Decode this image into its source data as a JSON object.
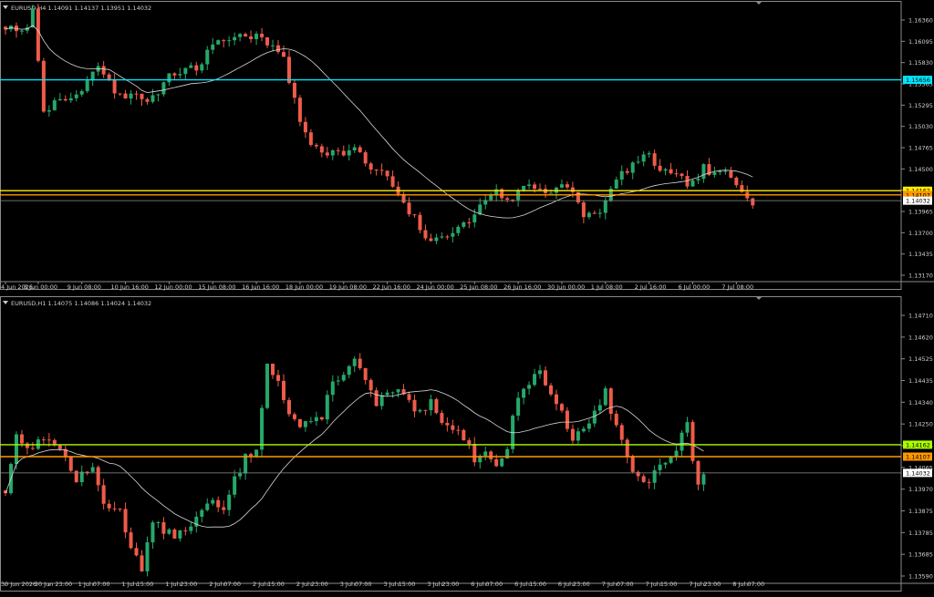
{
  "chart_data": [
    {
      "type": "candlestick",
      "title": "EURUSD,H4  1.14091 1.14137 1.13951 1.14032",
      "ylim": [
        1.1301,
        1.1651
      ],
      "y_ticks": [
        "1.16360",
        "1.16095",
        "1.15830",
        "1.15565",
        "1.15295",
        "1.15030",
        "1.14765",
        "1.14500",
        "1.14235",
        "1.13965",
        "1.13700",
        "1.13435",
        "1.13170"
      ],
      "x_ticks": [
        "4 Jun 2026",
        "8 Jun 00:00",
        "9 Jun 08:00",
        "10 Jun 16:00",
        "12 Jun 00:00",
        "15 Jun 08:00",
        "16 Jun 16:00",
        "18 Jun 00:00",
        "19 Jun 08:00",
        "22 Jun 16:00",
        "24 Jun 00:00",
        "25 Jun 08:00",
        "26 Jun 16:00",
        "30 Jun 00:00",
        "1 Jul 08:00",
        "2 Jul 16:00",
        "6 Jul 00:00",
        "7 Jul 08:00"
      ],
      "x_tick_index": [
        0,
        6,
        14,
        22,
        30,
        38,
        46,
        54,
        62,
        70,
        78,
        86,
        94,
        102,
        110,
        118,
        126,
        134
      ],
      "levels": [
        {
          "value": 1.1561,
          "label": "1.15656",
          "color": "#00e5ff"
        },
        {
          "value": 1.14162,
          "label": "1.14162",
          "color": "#ffee00"
        },
        {
          "value": 1.14107,
          "label": "1.14107",
          "color": "#ff9800"
        },
        {
          "value": 1.14032,
          "label": "1.14032",
          "color": "#909090"
        }
      ],
      "waypoints": [
        [
          0,
          1.163
        ],
        [
          3,
          1.162
        ],
        [
          5,
          1.165
        ],
        [
          7,
          1.1525
        ],
        [
          10,
          1.153
        ],
        [
          14,
          1.1545
        ],
        [
          17,
          1.158
        ],
        [
          20,
          1.1545
        ],
        [
          23,
          1.154
        ],
        [
          27,
          1.1535
        ],
        [
          30,
          1.157
        ],
        [
          33,
          1.1575
        ],
        [
          36,
          1.158
        ],
        [
          38,
          1.161
        ],
        [
          41,
          1.1615
        ],
        [
          44,
          1.162
        ],
        [
          47,
          1.1615
        ],
        [
          49,
          1.16
        ],
        [
          51,
          1.1595
        ],
        [
          52,
          1.156
        ],
        [
          54,
          1.1505
        ],
        [
          56,
          1.148
        ],
        [
          58,
          1.147
        ],
        [
          61,
          1.1465
        ],
        [
          64,
          1.147
        ],
        [
          67,
          1.1445
        ],
        [
          70,
          1.1435
        ],
        [
          73,
          1.1395
        ],
        [
          75,
          1.138
        ],
        [
          78,
          1.1345
        ],
        [
          80,
          1.136
        ],
        [
          83,
          1.1365
        ],
        [
          86,
          1.1385
        ],
        [
          88,
          1.1405
        ],
        [
          90,
          1.142
        ],
        [
          92,
          1.14
        ],
        [
          94,
          1.1415
        ],
        [
          96,
          1.1425
        ],
        [
          99,
          1.1415
        ],
        [
          102,
          1.1425
        ],
        [
          104,
          1.141
        ],
        [
          106,
          1.1385
        ],
        [
          108,
          1.1385
        ],
        [
          110,
          1.14
        ],
        [
          112,
          1.143
        ],
        [
          114,
          1.1445
        ],
        [
          116,
          1.1455
        ],
        [
          118,
          1.146
        ],
        [
          120,
          1.1445
        ],
        [
          122,
          1.1435
        ],
        [
          124,
          1.143
        ],
        [
          126,
          1.1425
        ],
        [
          128,
          1.1445
        ],
        [
          130,
          1.1435
        ],
        [
          132,
          1.144
        ],
        [
          134,
          1.1425
        ],
        [
          136,
          1.1412
        ],
        [
          137,
          1.1403
        ]
      ],
      "ma_period": 20,
      "seed": 7
    },
    {
      "type": "candlestick",
      "title": "EURUSD,H1  1.14075 1.14086 1.14024 1.14032",
      "ylim": [
        1.1354,
        1.148
      ],
      "y_ticks": [
        "1.14710",
        "1.14620",
        "1.14525",
        "1.14435",
        "1.14340",
        "1.14250",
        "1.14155",
        "1.14065",
        "1.13970",
        "1.13875",
        "1.13785",
        "1.13685",
        "1.13590"
      ],
      "x_ticks": [
        "30 Jun 2026",
        "30 Jun 23:00",
        "1 Jul 07:00",
        "1 Jul 15:00",
        "1 Jul 23:00",
        "2 Jul 07:00",
        "2 Jul 15:00",
        "2 Jul 23:00",
        "3 Jul 07:00",
        "3 Jul 15:00",
        "3 Jul 23:00",
        "6 Jul 07:00",
        "6 Jul 15:00",
        "6 Jul 23:00",
        "7 Jul 07:00",
        "7 Jul 15:00",
        "7 Jul 23:00",
        "8 Jul 07:00"
      ],
      "x_tick_index": [
        0,
        8,
        16,
        24,
        32,
        40,
        48,
        56,
        64,
        72,
        80,
        88,
        96,
        104,
        112,
        120,
        128,
        136
      ],
      "levels": [
        {
          "value": 1.14162,
          "label": "1.14162",
          "color": "#aaff00"
        },
        {
          "value": 1.14107,
          "label": "1.14107",
          "color": "#ff9800"
        },
        {
          "value": 1.14032,
          "label": "1.14032",
          "color": "#909090"
        }
      ],
      "waypoints": [
        [
          0,
          1.1395
        ],
        [
          2,
          1.142
        ],
        [
          5,
          1.1415
        ],
        [
          8,
          1.142
        ],
        [
          11,
          1.141
        ],
        [
          13,
          1.14
        ],
        [
          16,
          1.1405
        ],
        [
          18,
          1.139
        ],
        [
          21,
          1.1385
        ],
        [
          23,
          1.137
        ],
        [
          25,
          1.136
        ],
        [
          27,
          1.138
        ],
        [
          30,
          1.1375
        ],
        [
          32,
          1.1375
        ],
        [
          34,
          1.138
        ],
        [
          36,
          1.1385
        ],
        [
          38,
          1.139
        ],
        [
          40,
          1.1385
        ],
        [
          42,
          1.14
        ],
        [
          44,
          1.141
        ],
        [
          46,
          1.1415
        ],
        [
          48,
          1.1455
        ],
        [
          50,
          1.1445
        ],
        [
          52,
          1.143
        ],
        [
          54,
          1.1425
        ],
        [
          56,
          1.1425
        ],
        [
          58,
          1.143
        ],
        [
          60,
          1.1445
        ],
        [
          62,
          1.145
        ],
        [
          64,
          1.1455
        ],
        [
          66,
          1.1445
        ],
        [
          68,
          1.1435
        ],
        [
          70,
          1.144
        ],
        [
          72,
          1.144
        ],
        [
          74,
          1.1435
        ],
        [
          76,
          1.143
        ],
        [
          78,
          1.1435
        ],
        [
          80,
          1.1425
        ],
        [
          82,
          1.1425
        ],
        [
          84,
          1.142
        ],
        [
          86,
          1.141
        ],
        [
          88,
          1.1415
        ],
        [
          90,
          1.1405
        ],
        [
          92,
          1.1415
        ],
        [
          94,
          1.144
        ],
        [
          96,
          1.1445
        ],
        [
          98,
          1.145
        ],
        [
          100,
          1.144
        ],
        [
          102,
          1.143
        ],
        [
          104,
          1.142
        ],
        [
          106,
          1.1425
        ],
        [
          108,
          1.143
        ],
        [
          110,
          1.144
        ],
        [
          112,
          1.1425
        ],
        [
          114,
          1.141
        ],
        [
          116,
          1.14
        ],
        [
          118,
          1.14
        ],
        [
          120,
          1.1405
        ],
        [
          122,
          1.141
        ],
        [
          124,
          1.142
        ],
        [
          125,
          1.1425
        ],
        [
          126,
          1.141
        ],
        [
          127,
          1.1398
        ],
        [
          128,
          1.1403
        ]
      ],
      "ma_period": 20,
      "seed": 13
    }
  ]
}
